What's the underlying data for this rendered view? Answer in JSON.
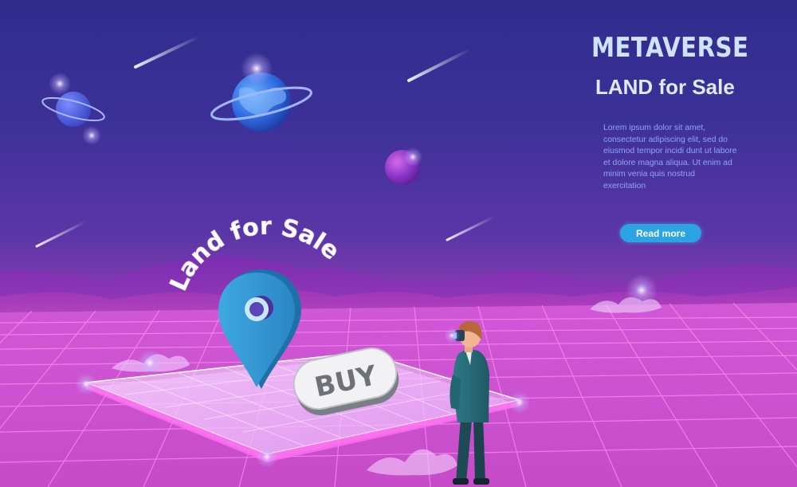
{
  "hero": {
    "title": "METAVERSE",
    "subtitle": "LAND for Sale",
    "body": "Lorem ipsum dolor sit amet, consectetur adipiscing elit, sed do eiusmod tempor incidi dunt ut labore et dolore magna aliqua. Ut enim ad minim venia quis nostrud exercitation",
    "cta_label": "Read more"
  },
  "illustration": {
    "arc_text": "Land for Sale",
    "buy_label": "BUY"
  },
  "colors": {
    "sky_top": "#2f2c8c",
    "sky_bottom": "#c44cc6",
    "grid_line": "#ff8cf0",
    "cta": "#2aa4e2",
    "pin": "#3a9fd8",
    "title": "#cfe3ff"
  },
  "icons": [
    "planet-icon",
    "map-pin-icon",
    "shooting-star-icon"
  ]
}
